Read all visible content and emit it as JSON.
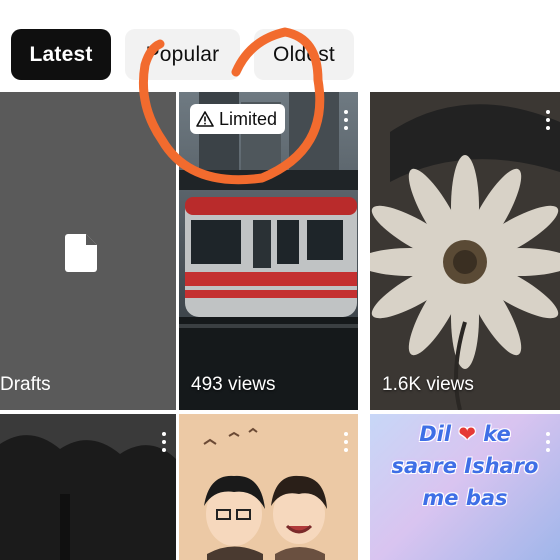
{
  "chips": {
    "latest": "Latest",
    "popular": "Popular",
    "oldest": "Oldest"
  },
  "grid": {
    "drafts_label": "Drafts",
    "video2": {
      "badge": "Limited",
      "views": "493 views"
    },
    "video3": {
      "views": "1.6K views"
    },
    "video6": {
      "overlay_line1": "Dil",
      "overlay_line1b": "ke",
      "overlay_line2": "saare Isharo",
      "overlay_line3": "me bas"
    }
  },
  "colors": {
    "chip_active_bg": "#0f0f0f",
    "chip_bg": "#f2f2f2",
    "annotation": "#f26b2e"
  }
}
